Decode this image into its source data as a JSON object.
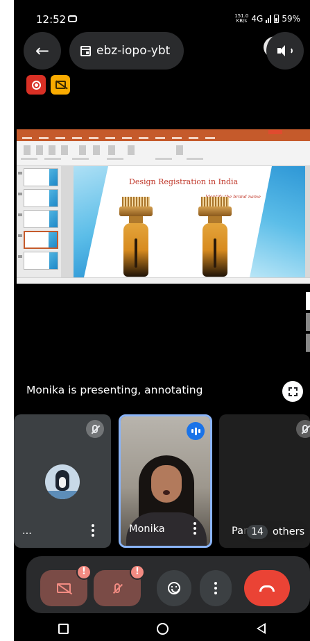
{
  "status_bar": {
    "time": "12:52",
    "network_rate": "151.0",
    "network_unit": "KB/s",
    "network_type": "4G",
    "battery": "59%"
  },
  "top_bar": {
    "meeting_code": "ebz-iopo-ybt"
  },
  "presentation": {
    "slide_title": "Design Registration in India",
    "slide_subtitle": "Identify the brand name"
  },
  "presenting_text": "Monika is presenting, annotating",
  "participants": [
    {
      "name": "...",
      "muted": true
    },
    {
      "name": "Monika",
      "speaking": true
    },
    {
      "name": "Pan",
      "muted": true
    }
  ],
  "others": {
    "count": "14",
    "label": "others"
  },
  "controls": {
    "camera_alert": "!",
    "mic_alert": "!"
  },
  "colors": {
    "background": "#000000",
    "accent_blue": "#8ab4f8",
    "end_call": "#ea4335",
    "off_state": "#7a4b46"
  }
}
